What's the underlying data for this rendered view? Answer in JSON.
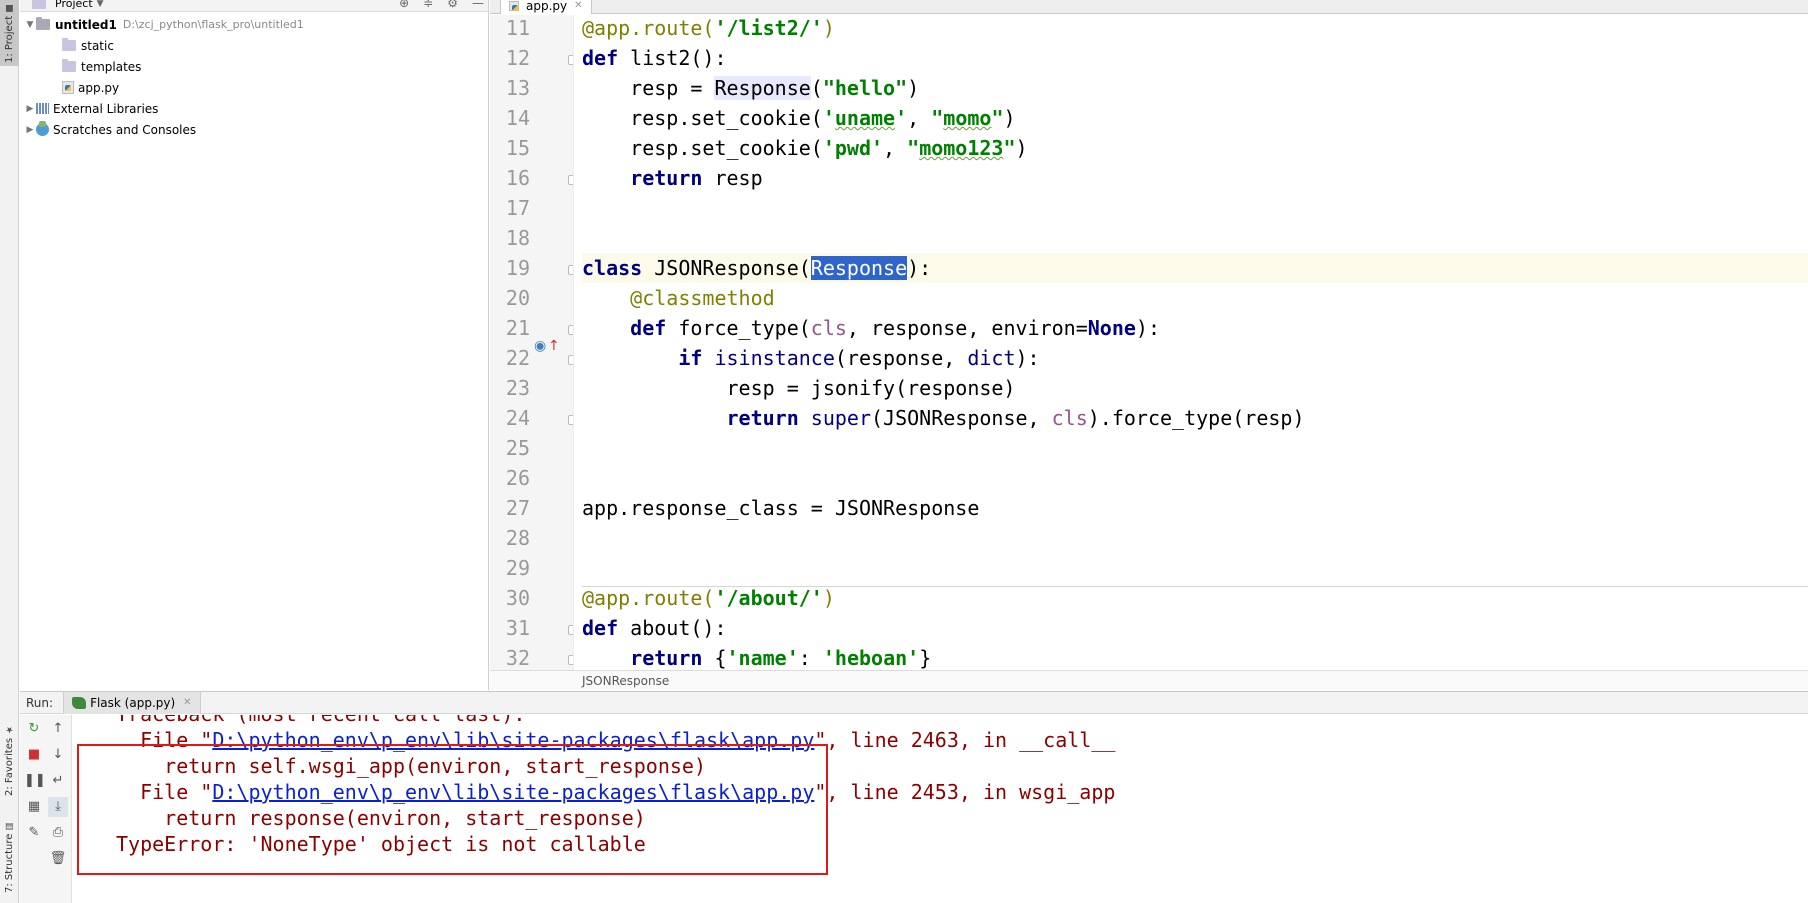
{
  "tool_strip": {
    "project_tab": "1: Project",
    "favorites_tab": "2: Favorites",
    "structure_tab": "7: Structure"
  },
  "project_panel": {
    "title": "Project",
    "root": {
      "name": "untitled1",
      "path": "D:\\zcj_python\\flask_pro\\untitled1"
    },
    "items": [
      {
        "label": "static",
        "icon": "folder-icon"
      },
      {
        "label": "templates",
        "icon": "folder-icon"
      },
      {
        "label": "app.py",
        "icon": "python-file-icon"
      },
      {
        "label": "External Libraries",
        "icon": "library-icon"
      },
      {
        "label": "Scratches and Consoles",
        "icon": "scratches-icon"
      }
    ]
  },
  "editor": {
    "tab_label": "app.py",
    "breadcrumb": "JSONResponse",
    "current_line": 19,
    "lines": [
      {
        "no": "11",
        "code": "@app.route('/list2/')"
      },
      {
        "no": "12",
        "code": "def list2():"
      },
      {
        "no": "13",
        "code": "    resp = Response(\"hello\")"
      },
      {
        "no": "14",
        "code": "    resp.set_cookie('uname', \"momo\")"
      },
      {
        "no": "15",
        "code": "    resp.set_cookie('pwd', \"momo123\")"
      },
      {
        "no": "16",
        "code": "    return resp"
      },
      {
        "no": "17",
        "code": ""
      },
      {
        "no": "18",
        "code": ""
      },
      {
        "no": "19",
        "code": "class JSONResponse(Response):"
      },
      {
        "no": "20",
        "code": "    @classmethod"
      },
      {
        "no": "21",
        "code": "    def force_type(cls, response, environ=None):"
      },
      {
        "no": "22",
        "code": "        if isinstance(response, dict):"
      },
      {
        "no": "23",
        "code": "            resp = jsonify(response)"
      },
      {
        "no": "24",
        "code": "            return super(JSONResponse, cls).force_type(resp)"
      },
      {
        "no": "25",
        "code": ""
      },
      {
        "no": "26",
        "code": ""
      },
      {
        "no": "27",
        "code": "app.response_class = JSONResponse"
      },
      {
        "no": "28",
        "code": ""
      },
      {
        "no": "29",
        "code": ""
      },
      {
        "no": "30",
        "code": "@app.route('/about/')"
      },
      {
        "no": "31",
        "code": "def about():"
      },
      {
        "no": "32",
        "code": "    return {'name': 'heboan'}"
      }
    ]
  },
  "run_panel": {
    "label": "Run:",
    "tab_label": "Flask (app.py)",
    "console": {
      "line0": "Traceback (most recent call last):",
      "line1_prefix": "  File \"",
      "line1_link": "D:\\python_env\\p_env\\lib\\site-packages\\flask\\app.py",
      "line1_suffix": "\", line 2463, in __call__",
      "line2": "    return self.wsgi_app(environ, start_response)",
      "line3_prefix": "  File \"",
      "line3_link": "D:\\python_env\\p_env\\lib\\site-packages\\flask\\app.py",
      "line3_suffix": "\", line 2453, in wsgi_app",
      "line4": "    return response(environ, start_response)",
      "line5": "TypeError: 'NoneType' object is not callable"
    }
  },
  "colors": {
    "keyword": "#000080",
    "string": "#008000",
    "decorator": "#808000",
    "error_text": "#8b0000",
    "link": "#0b21d0",
    "highlight_box": "#e01818"
  }
}
